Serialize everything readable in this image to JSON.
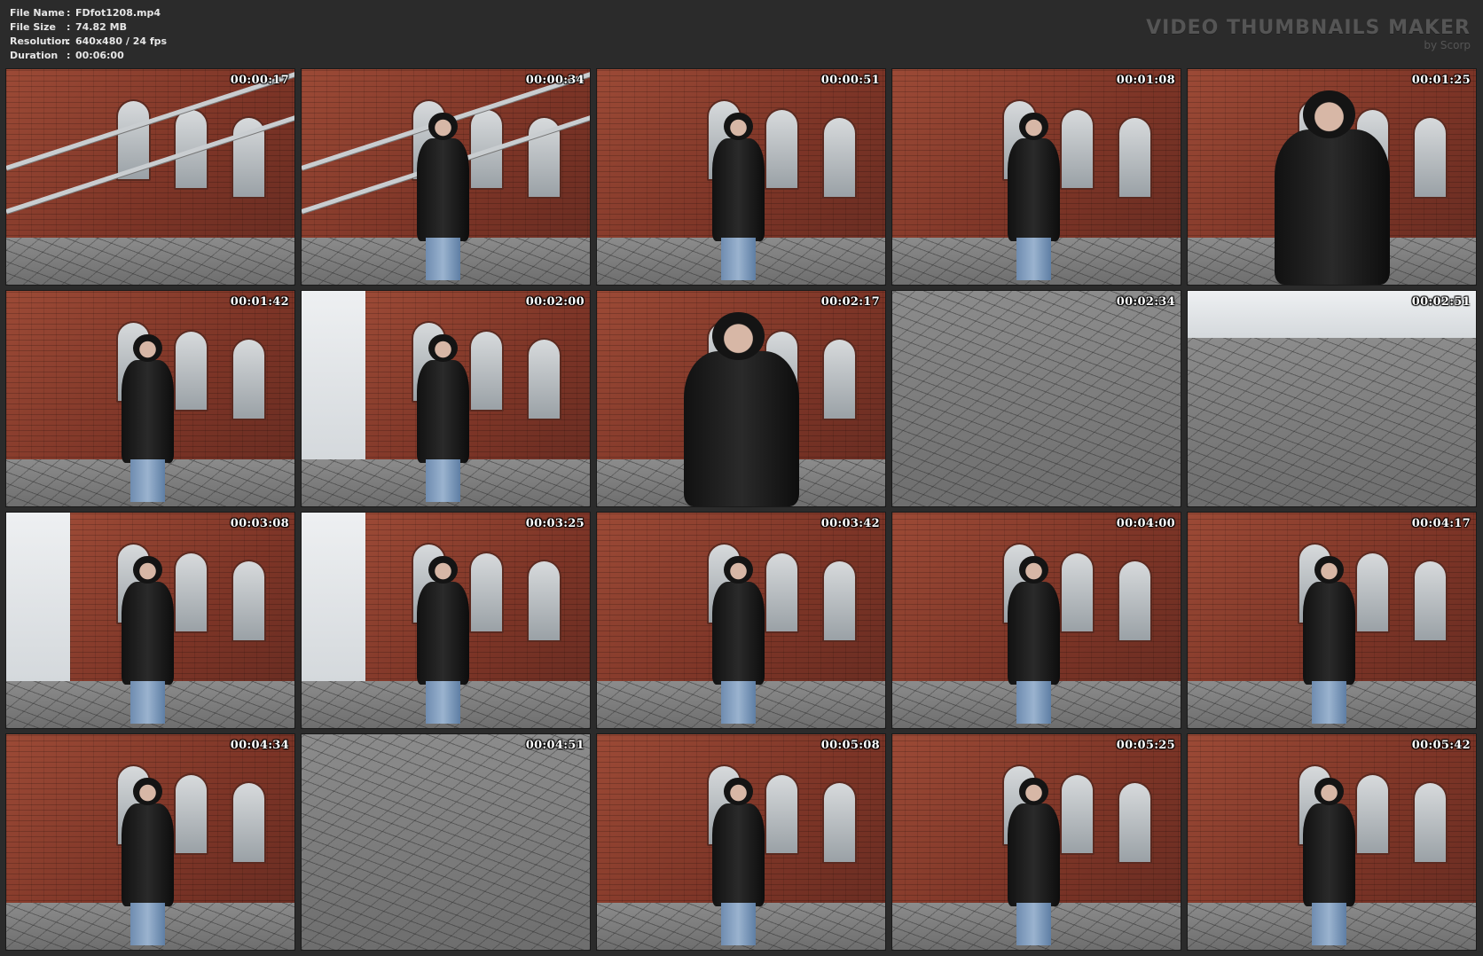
{
  "header": {
    "info": [
      {
        "key": "File Name",
        "value": "FDfot1208.mp4"
      },
      {
        "key": "File Size",
        "value": "74.82 MB"
      },
      {
        "key": "Resolution",
        "value": "640x480 / 24 fps"
      },
      {
        "key": "Duration",
        "value": "00:06:00"
      }
    ],
    "separator": ":",
    "brand_title": "VIDEO THUMBNAILS MAKER",
    "brand_sub": "by Scorp"
  },
  "thumbnails": [
    {
      "timestamp": "00:00:17"
    },
    {
      "timestamp": "00:00:34"
    },
    {
      "timestamp": "00:00:51"
    },
    {
      "timestamp": "00:01:08"
    },
    {
      "timestamp": "00:01:25"
    },
    {
      "timestamp": "00:01:42"
    },
    {
      "timestamp": "00:02:00"
    },
    {
      "timestamp": "00:02:17"
    },
    {
      "timestamp": "00:02:34"
    },
    {
      "timestamp": "00:02:51"
    },
    {
      "timestamp": "00:03:08"
    },
    {
      "timestamp": "00:03:25"
    },
    {
      "timestamp": "00:03:42"
    },
    {
      "timestamp": "00:04:00"
    },
    {
      "timestamp": "00:04:17"
    },
    {
      "timestamp": "00:04:34"
    },
    {
      "timestamp": "00:04:51"
    },
    {
      "timestamp": "00:05:08"
    },
    {
      "timestamp": "00:05:25"
    },
    {
      "timestamp": "00:05:42"
    }
  ]
}
